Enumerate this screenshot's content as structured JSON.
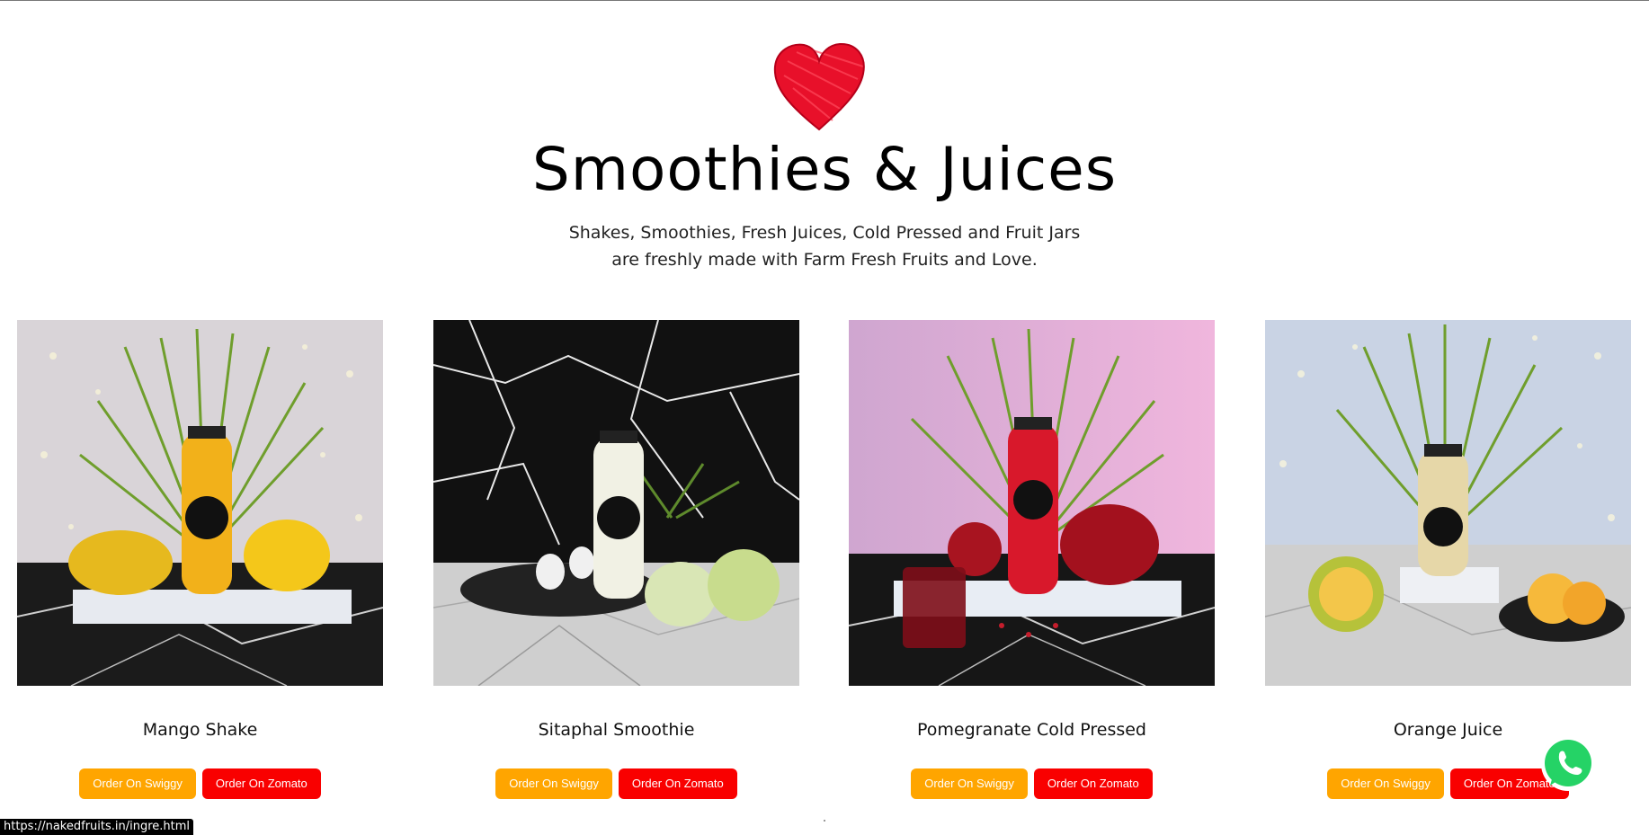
{
  "header": {
    "icon": "heart-icon",
    "title": "Smoothies & Juices",
    "subtitle_line1": "Shakes, Smoothies, Fresh Juices, Cold Pressed and Fruit Jars",
    "subtitle_line2": "are freshly made with Farm Fresh Fruits and Love."
  },
  "products": [
    {
      "name": "Mango Shake",
      "swiggy_label": "Order On Swiggy",
      "zomato_label": "Order On Zomato",
      "drink_color": "#f2b11a"
    },
    {
      "name": "Sitaphal Smoothie",
      "swiggy_label": "Order On Swiggy",
      "zomato_label": "Order On Zomato",
      "drink_color": "#f1f1e4"
    },
    {
      "name": "Pomegranate Cold Pressed",
      "swiggy_label": "Order On Swiggy",
      "zomato_label": "Order On Zomato",
      "drink_color": "#d8182b"
    },
    {
      "name": "Orange Juice",
      "swiggy_label": "Order On Swiggy",
      "zomato_label": "Order On Zomato",
      "drink_color": "#e6d7a8"
    }
  ],
  "colors": {
    "swiggy": "#ffa500",
    "zomato": "#f90000",
    "heart": "#e8102a",
    "whatsapp": "#25d366"
  },
  "status_url": "https://nakedfruits.in/ingre.html",
  "floating": {
    "icon": "whatsapp-icon"
  }
}
